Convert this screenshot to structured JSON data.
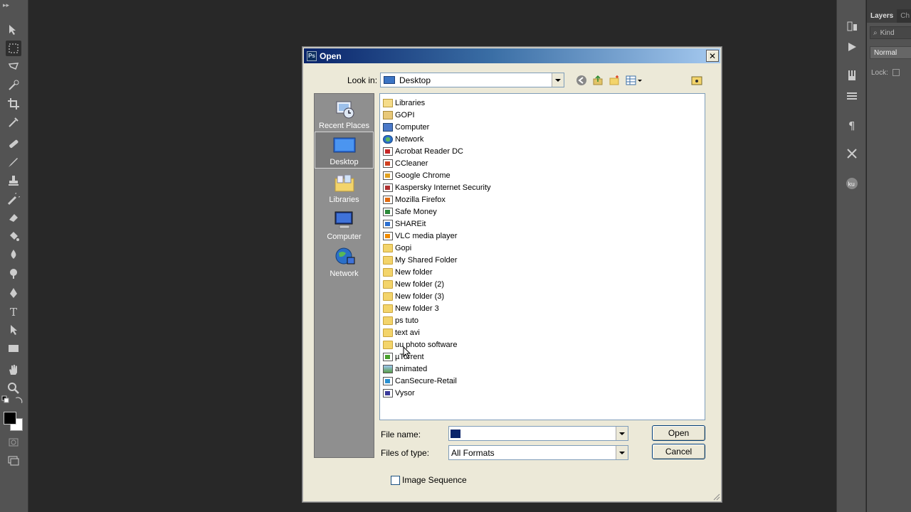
{
  "dialog": {
    "title": "Open",
    "title_icon_text": "Ps",
    "close_glyph": "✕",
    "look_in_label": "Look in:",
    "look_in_value": "Desktop",
    "file_name_label": "File name:",
    "file_name_value": "",
    "files_of_type_label": "Files of type:",
    "files_of_type_value": "All Formats",
    "open_button": "Open",
    "cancel_button": "Cancel",
    "image_sequence_label": "Image Sequence",
    "image_sequence_checked": false
  },
  "places": [
    {
      "label": "Recent Places",
      "icon": "recent-places-icon"
    },
    {
      "label": "Desktop",
      "icon": "desktop-icon",
      "selected": true
    },
    {
      "label": "Libraries",
      "icon": "libraries-icon"
    },
    {
      "label": "Computer",
      "icon": "computer-icon"
    },
    {
      "label": "Network",
      "icon": "network-icon"
    }
  ],
  "files": [
    {
      "name": "Libraries",
      "icon": "library-icon",
      "kind": "lib"
    },
    {
      "name": "GOPI",
      "icon": "user-folder-icon",
      "kind": "user"
    },
    {
      "name": "Computer",
      "icon": "computer-icon",
      "kind": "comp"
    },
    {
      "name": "Network",
      "icon": "network-icon",
      "kind": "net"
    },
    {
      "name": "Acrobat Reader DC",
      "icon": "acrobat-shortcut-icon",
      "kind": "app",
      "color": "#c62828"
    },
    {
      "name": "CCleaner",
      "icon": "ccleaner-shortcut-icon",
      "kind": "app",
      "color": "#d04020"
    },
    {
      "name": "Google Chrome",
      "icon": "chrome-shortcut-icon",
      "kind": "app",
      "color": "#e0a020"
    },
    {
      "name": "Kaspersky Internet Security",
      "icon": "kaspersky-shortcut-icon",
      "kind": "app",
      "color": "#b03030"
    },
    {
      "name": "Mozilla Firefox",
      "icon": "firefox-shortcut-icon",
      "kind": "app",
      "color": "#e06a10"
    },
    {
      "name": "Safe Money",
      "icon": "safe-money-shortcut-icon",
      "kind": "app",
      "color": "#2c8a3a"
    },
    {
      "name": "SHAREit",
      "icon": "shareit-shortcut-icon",
      "kind": "app",
      "color": "#2a6fd0"
    },
    {
      "name": "VLC media player",
      "icon": "vlc-shortcut-icon",
      "kind": "app",
      "color": "#f08a00"
    },
    {
      "name": "Gopi",
      "icon": "folder-icon",
      "kind": "folder"
    },
    {
      "name": "My Shared Folder",
      "icon": "folder-icon",
      "kind": "folder"
    },
    {
      "name": "New folder",
      "icon": "folder-icon",
      "kind": "folder"
    },
    {
      "name": "New folder (2)",
      "icon": "folder-icon",
      "kind": "folder"
    },
    {
      "name": "New folder (3)",
      "icon": "folder-icon",
      "kind": "folder"
    },
    {
      "name": "New folder 3",
      "icon": "folder-icon",
      "kind": "folder"
    },
    {
      "name": "ps tuto",
      "icon": "folder-icon",
      "kind": "folder"
    },
    {
      "name": "text avi",
      "icon": "folder-icon",
      "kind": "folder"
    },
    {
      "name": "uu photo software",
      "icon": "folder-icon",
      "kind": "folder"
    },
    {
      "name": "µTorrent",
      "icon": "utorrent-shortcut-icon",
      "kind": "app",
      "color": "#4aa02c"
    },
    {
      "name": "animated",
      "icon": "image-file-icon",
      "kind": "img"
    },
    {
      "name": "CanSecure-Retail",
      "icon": "cansecure-icon",
      "kind": "app",
      "color": "#2a90d0"
    },
    {
      "name": "Vysor",
      "icon": "vysor-shortcut-icon",
      "kind": "app",
      "color": "#3a3a9a"
    }
  ],
  "ps_panel": {
    "tab_layers": "Layers",
    "tab_channels": "Ch",
    "kind_label": "Kind",
    "blend_mode": "Normal",
    "lock_label": "Lock:"
  },
  "colors": {
    "dialog_bg": "#ece9d8",
    "title_start": "#0a246a",
    "title_end": "#a6caf0",
    "places_bg": "#8f8f8f",
    "ps_ui": "#535353",
    "ps_canvas": "#282828"
  }
}
